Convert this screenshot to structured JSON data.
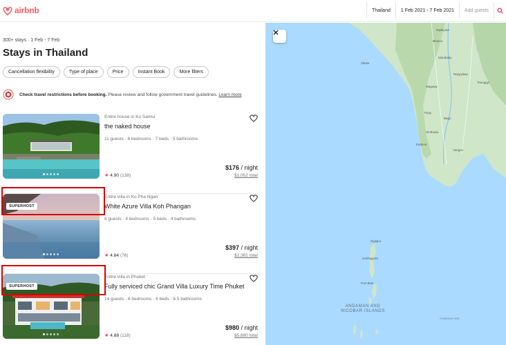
{
  "header": {
    "logo_text": "airbnb",
    "brand_color": "#ff5a5f",
    "search": {
      "location": "Thailand",
      "dates": "1 Feb 2021 - 7 Feb 2021",
      "guests_placeholder": "Add guests",
      "search_icon": "search-icon"
    }
  },
  "results": {
    "count_text": "300+ stays · 1 Feb - 7 Feb",
    "title": "Stays in Thailand",
    "filters": [
      "Cancellation flexibility",
      "Type of place",
      "Price",
      "Instant Book",
      "More filters"
    ]
  },
  "alert": {
    "bold": "Check travel restrictions before booking.",
    "text": "Please review and follow government travel guidelines.",
    "link": "Learn more"
  },
  "listings": [
    {
      "type": "Entire house in Ko Samui",
      "name": "the naked house",
      "details": "11 guests · 6 bedrooms · 7 beds · 5 bathrooms",
      "price": "$176",
      "price_unit": " / night",
      "total": "$1,052 total",
      "rating": "4.90",
      "reviews": "(138)",
      "badge": ""
    },
    {
      "type": "Entire villa in Ko Pha Ngan",
      "name": "White Azure Villa Koh Phangan",
      "details": "8 guests · 4 bedrooms · 5 beds · 4 bathrooms",
      "price": "$397",
      "price_unit": " / night",
      "total": "$2,381 total",
      "rating": "4.84",
      "reviews": "(76)",
      "badge": "SUPERHOST"
    },
    {
      "type": "Entire villa in Phuket",
      "name": "Fully serviced chic Grand Villa Luxury Time Phuket",
      "details": "14 guests · 6 bedrooms · 6 beds · 6.5 bathrooms",
      "price": "$980",
      "price_unit": " / night",
      "total": "$5,880 total",
      "rating": "4.88",
      "reviews": "(118)",
      "badge": "SUPERHOST"
    }
  ],
  "map": {
    "places": [
      "Myitkyina",
      "Bhamo",
      "Mandalay",
      "Naypyitaw",
      "Taunggyi",
      "Magway",
      "Bago",
      "Pyay",
      "Pathein",
      "Yangon",
      "Hinthada",
      "Sittwe",
      "Subhagram",
      "Port Blair",
      "Diglipur"
    ],
    "region_label": "ANDAMAN AND NICOBAR ISLANDS",
    "sea_label": "Andaman Sea",
    "close_icon": "close-icon"
  }
}
